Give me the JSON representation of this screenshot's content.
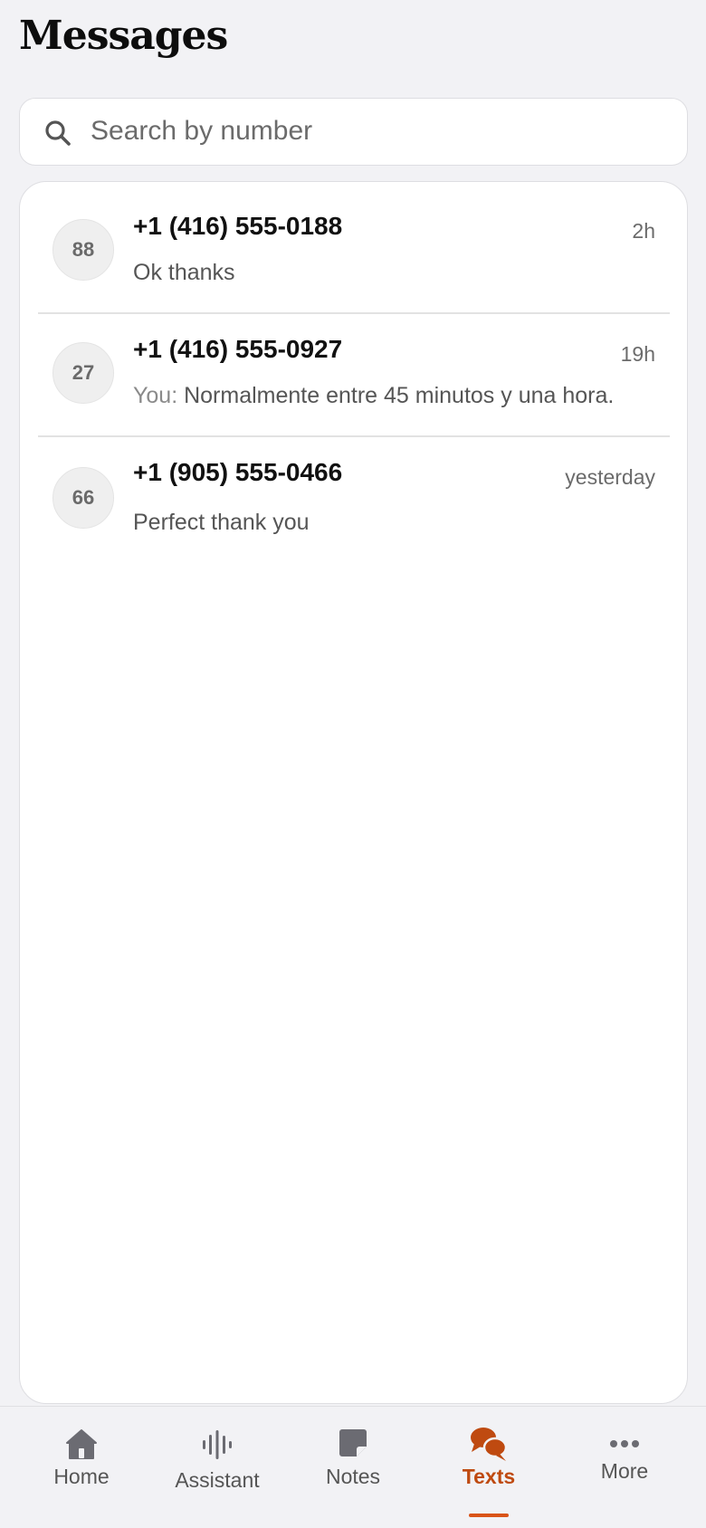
{
  "header": {
    "title": "Messages"
  },
  "search": {
    "placeholder": "Search by number",
    "value": ""
  },
  "threads": [
    {
      "avatar": "88",
      "number": "+1 (416) 555-0188",
      "time": "2h",
      "prefix": "",
      "preview": "Ok thanks"
    },
    {
      "avatar": "27",
      "number": "+1 (416) 555-0927",
      "time": "19h",
      "prefix": "You: ",
      "preview": "Normalmente entre 45 minutos y una hora."
    },
    {
      "avatar": "66",
      "number": "+1 (905) 555-0466",
      "time": "yesterday",
      "prefix": "",
      "preview": "Perfect thank you"
    }
  ],
  "tabbar": {
    "active": "texts",
    "items": [
      {
        "key": "home",
        "label": "Home",
        "icon": "home-icon"
      },
      {
        "key": "assistant",
        "label": "Assistant",
        "icon": "waveform-icon"
      },
      {
        "key": "notes",
        "label": "Notes",
        "icon": "note-icon"
      },
      {
        "key": "texts",
        "label": "Texts",
        "icon": "chat-bubbles-icon"
      },
      {
        "key": "more",
        "label": "More",
        "icon": "more-dots-icon"
      }
    ]
  },
  "colors": {
    "accent": "#bf4a10",
    "indicator": "#d95418",
    "background": "#f2f2f5",
    "icon_gray": "#6b6b72"
  }
}
